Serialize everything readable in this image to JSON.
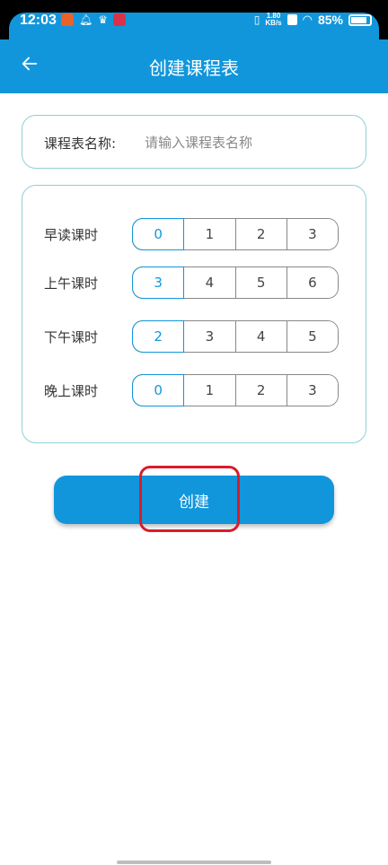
{
  "status_bar": {
    "time": "12:03",
    "net_speed_value": "1.80",
    "net_speed_unit": "KB/s",
    "battery": "85%"
  },
  "app_bar": {
    "title": "创建课程表",
    "back_icon": "arrow-left-icon"
  },
  "name_field": {
    "label": "课程表名称:",
    "placeholder": "请输入课程表名称",
    "value": ""
  },
  "hour_rows": [
    {
      "label": "早读课时",
      "options": [
        "0",
        "1",
        "2",
        "3"
      ],
      "selected": "0"
    },
    {
      "label": "上午课时",
      "options": [
        "3",
        "4",
        "5",
        "6"
      ],
      "selected": "3"
    },
    {
      "label": "下午课时",
      "options": [
        "2",
        "3",
        "4",
        "5"
      ],
      "selected": "2"
    },
    {
      "label": "晚上课时",
      "options": [
        "0",
        "1",
        "2",
        "3"
      ],
      "selected": "0"
    }
  ],
  "create_button": {
    "label": "创建"
  },
  "colors": {
    "primary": "#1296db",
    "card_border": "#8fcfd6",
    "highlight": "#d91c2a"
  }
}
